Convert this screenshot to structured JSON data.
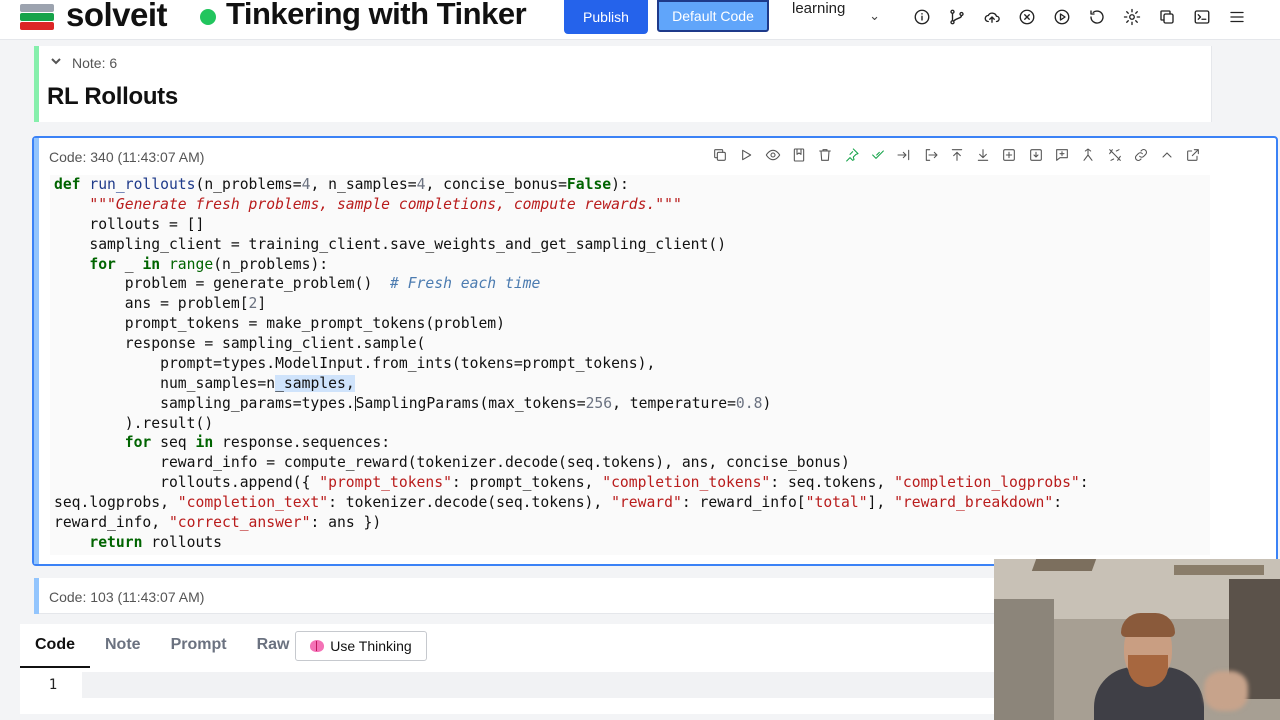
{
  "header": {
    "brand": "solveit",
    "dialog_title": "Tinkering with Tinker",
    "publish_label": "Publish",
    "default_code_label": "Default Code",
    "mode": "learning",
    "icons": [
      "info-icon",
      "git-branch-icon",
      "upload-cloud-icon",
      "stop-circle-icon",
      "play-circle-icon",
      "refresh-icon",
      "settings-icon",
      "copy-icon",
      "terminal-icon",
      "menu-icon"
    ]
  },
  "note_cell": {
    "header": "Note: 6",
    "heading": "RL Rollouts"
  },
  "code_cell": {
    "header": "Code: 340 (11:43:07 AM)",
    "toolbar_icons": [
      "copy-icon",
      "run-icon",
      "eye-icon",
      "bookmark-icon",
      "trash-icon",
      "pin-icon",
      "skip-icon",
      "indent-icon",
      "outdent-icon",
      "move-top-icon",
      "move-down-icon",
      "add-cell-icon",
      "export-icon",
      "comment-icon",
      "merge-icon",
      "split-icon",
      "link-icon",
      "collapse-icon",
      "open-external-icon"
    ],
    "lines": [
      [
        {
          "t": "def",
          "c": "kw"
        },
        {
          "t": " "
        },
        {
          "t": "run_rollouts",
          "c": "fn"
        },
        {
          "t": "(n_problems="
        },
        {
          "t": "4",
          "c": "num"
        },
        {
          "t": ", n_samples="
        },
        {
          "t": "4",
          "c": "num"
        },
        {
          "t": ", concise_bonus="
        },
        {
          "t": "False",
          "c": "kw"
        },
        {
          "t": "):"
        }
      ],
      [
        {
          "t": "    "
        },
        {
          "t": "\"\"\"Generate fresh problems, sample completions, compute rewards.\"\"\"",
          "c": "doc"
        }
      ],
      [
        {
          "t": "    rollouts = []"
        }
      ],
      [
        {
          "t": "    sampling_client = training_client.save_weights_and_get_sampling_client()"
        }
      ],
      [
        {
          "t": "    "
        },
        {
          "t": "for",
          "c": "kw"
        },
        {
          "t": " _ "
        },
        {
          "t": "in",
          "c": "kw"
        },
        {
          "t": " "
        },
        {
          "t": "range",
          "c": "bi"
        },
        {
          "t": "(n_problems):"
        }
      ],
      [
        {
          "t": "        problem = generate_problem()  "
        },
        {
          "t": "# Fresh each time",
          "c": "com"
        }
      ],
      [
        {
          "t": "        ans = problem["
        },
        {
          "t": "2",
          "c": "num"
        },
        {
          "t": "]"
        }
      ],
      [
        {
          "t": "        prompt_tokens = make_prompt_tokens(problem)"
        }
      ],
      [
        {
          "t": "        response = sampling_client.sample("
        }
      ],
      [
        {
          "t": "            prompt=types.ModelInput.from_ints(tokens=prompt_tokens),"
        }
      ],
      [
        {
          "t": "            num_samples=n"
        },
        {
          "t": "_samples,",
          "c": "sel"
        }
      ],
      [
        {
          "t": "            sampling_params=types."
        },
        {
          "t": "",
          "c": "cursor"
        },
        {
          "t": "SamplingParams(max_tokens="
        },
        {
          "t": "256",
          "c": "num"
        },
        {
          "t": ", temperature="
        },
        {
          "t": "0.8",
          "c": "num"
        },
        {
          "t": ")"
        }
      ],
      [
        {
          "t": "        ).result()"
        }
      ],
      [
        {
          "t": "        "
        },
        {
          "t": "for",
          "c": "kw"
        },
        {
          "t": " seq "
        },
        {
          "t": "in",
          "c": "kw"
        },
        {
          "t": " response.sequences:"
        }
      ],
      [
        {
          "t": "            reward_info = compute_reward(tokenizer.decode(seq.tokens), ans, concise_bonus)"
        }
      ],
      [
        {
          "t": "            rollouts.append({ "
        },
        {
          "t": "\"prompt_tokens\"",
          "c": "str"
        },
        {
          "t": ": prompt_tokens, "
        },
        {
          "t": "\"completion_tokens\"",
          "c": "str"
        },
        {
          "t": ": seq.tokens, "
        },
        {
          "t": "\"completion_logprobs\"",
          "c": "str"
        },
        {
          "t": ":"
        }
      ],
      [
        {
          "t": "seq.logprobs, "
        },
        {
          "t": "\"completion_text\"",
          "c": "str"
        },
        {
          "t": ": tokenizer.decode(seq.tokens), "
        },
        {
          "t": "\"reward\"",
          "c": "str"
        },
        {
          "t": ": reward_info["
        },
        {
          "t": "\"total\"",
          "c": "str"
        },
        {
          "t": "], "
        },
        {
          "t": "\"reward_breakdown\"",
          "c": "str"
        },
        {
          "t": ":"
        }
      ],
      [
        {
          "t": "reward_info, "
        },
        {
          "t": "\"correct_answer\"",
          "c": "str"
        },
        {
          "t": ": ans })"
        }
      ],
      [
        {
          "t": "    "
        },
        {
          "t": "return",
          "c": "kw"
        },
        {
          "t": " rollouts"
        }
      ]
    ]
  },
  "code_cell_2": {
    "header": "Code: 103 (11:43:07 AM)"
  },
  "input_panel": {
    "tabs": [
      {
        "label": "Code",
        "active": true
      },
      {
        "label": "Note",
        "active": false
      },
      {
        "label": "Prompt",
        "active": false
      },
      {
        "label": "Raw",
        "active": false
      }
    ],
    "use_thinking_label": "Use Thinking",
    "line_number": "1",
    "value": ""
  },
  "colors": {
    "publish": "#2563eb",
    "default_code": "#60a5fa",
    "status_dot": "#22c55e",
    "note_bar": "#86efac",
    "code_border": "#3b82f6",
    "keyword": "#006400",
    "string": "#b91c1c",
    "comment": "#4b7bb0"
  }
}
